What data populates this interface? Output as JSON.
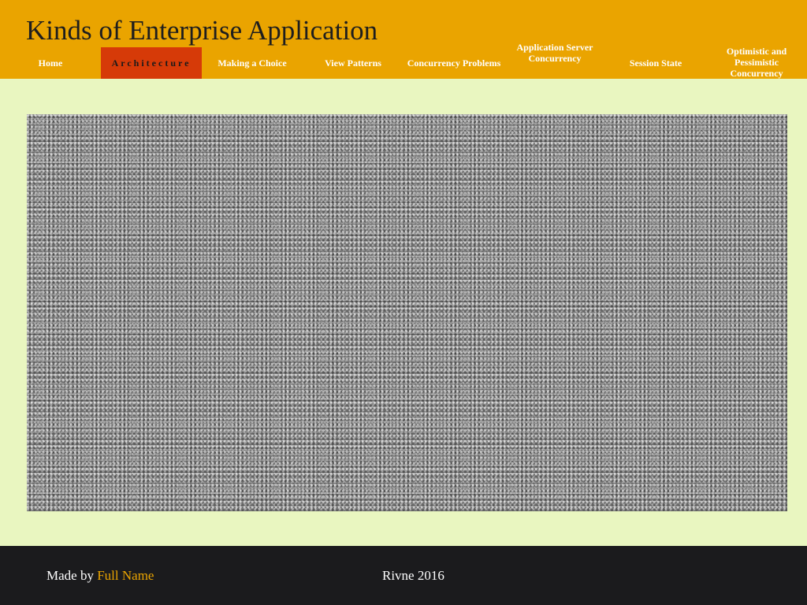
{
  "header": {
    "title": "Kinds of Enterprise Application"
  },
  "nav": {
    "items": [
      {
        "label": "Home",
        "active": false
      },
      {
        "label": "Architecture",
        "active": true
      },
      {
        "label": "Making a Choice",
        "active": false
      },
      {
        "label": "View Patterns",
        "active": false
      },
      {
        "label": "Concurrency Problems",
        "active": false
      },
      {
        "label": "Application Server Concurrency",
        "active": false
      },
      {
        "label": "Session State",
        "active": false
      },
      {
        "label": "Optimistic and Pessimistic Concurrency",
        "active": false
      }
    ]
  },
  "hero": {
    "image": "noise-texture-image"
  },
  "footer": {
    "made_by_prefix": "Made by ",
    "author": "Full Name",
    "location_year": "Rivne 2016"
  },
  "colors": {
    "header_bg": "#eaa400",
    "active_tab_bg": "#d63a08",
    "page_bg": "#e9f6c0",
    "footer_bg": "#1b1b1d",
    "link": "#eaa400"
  }
}
